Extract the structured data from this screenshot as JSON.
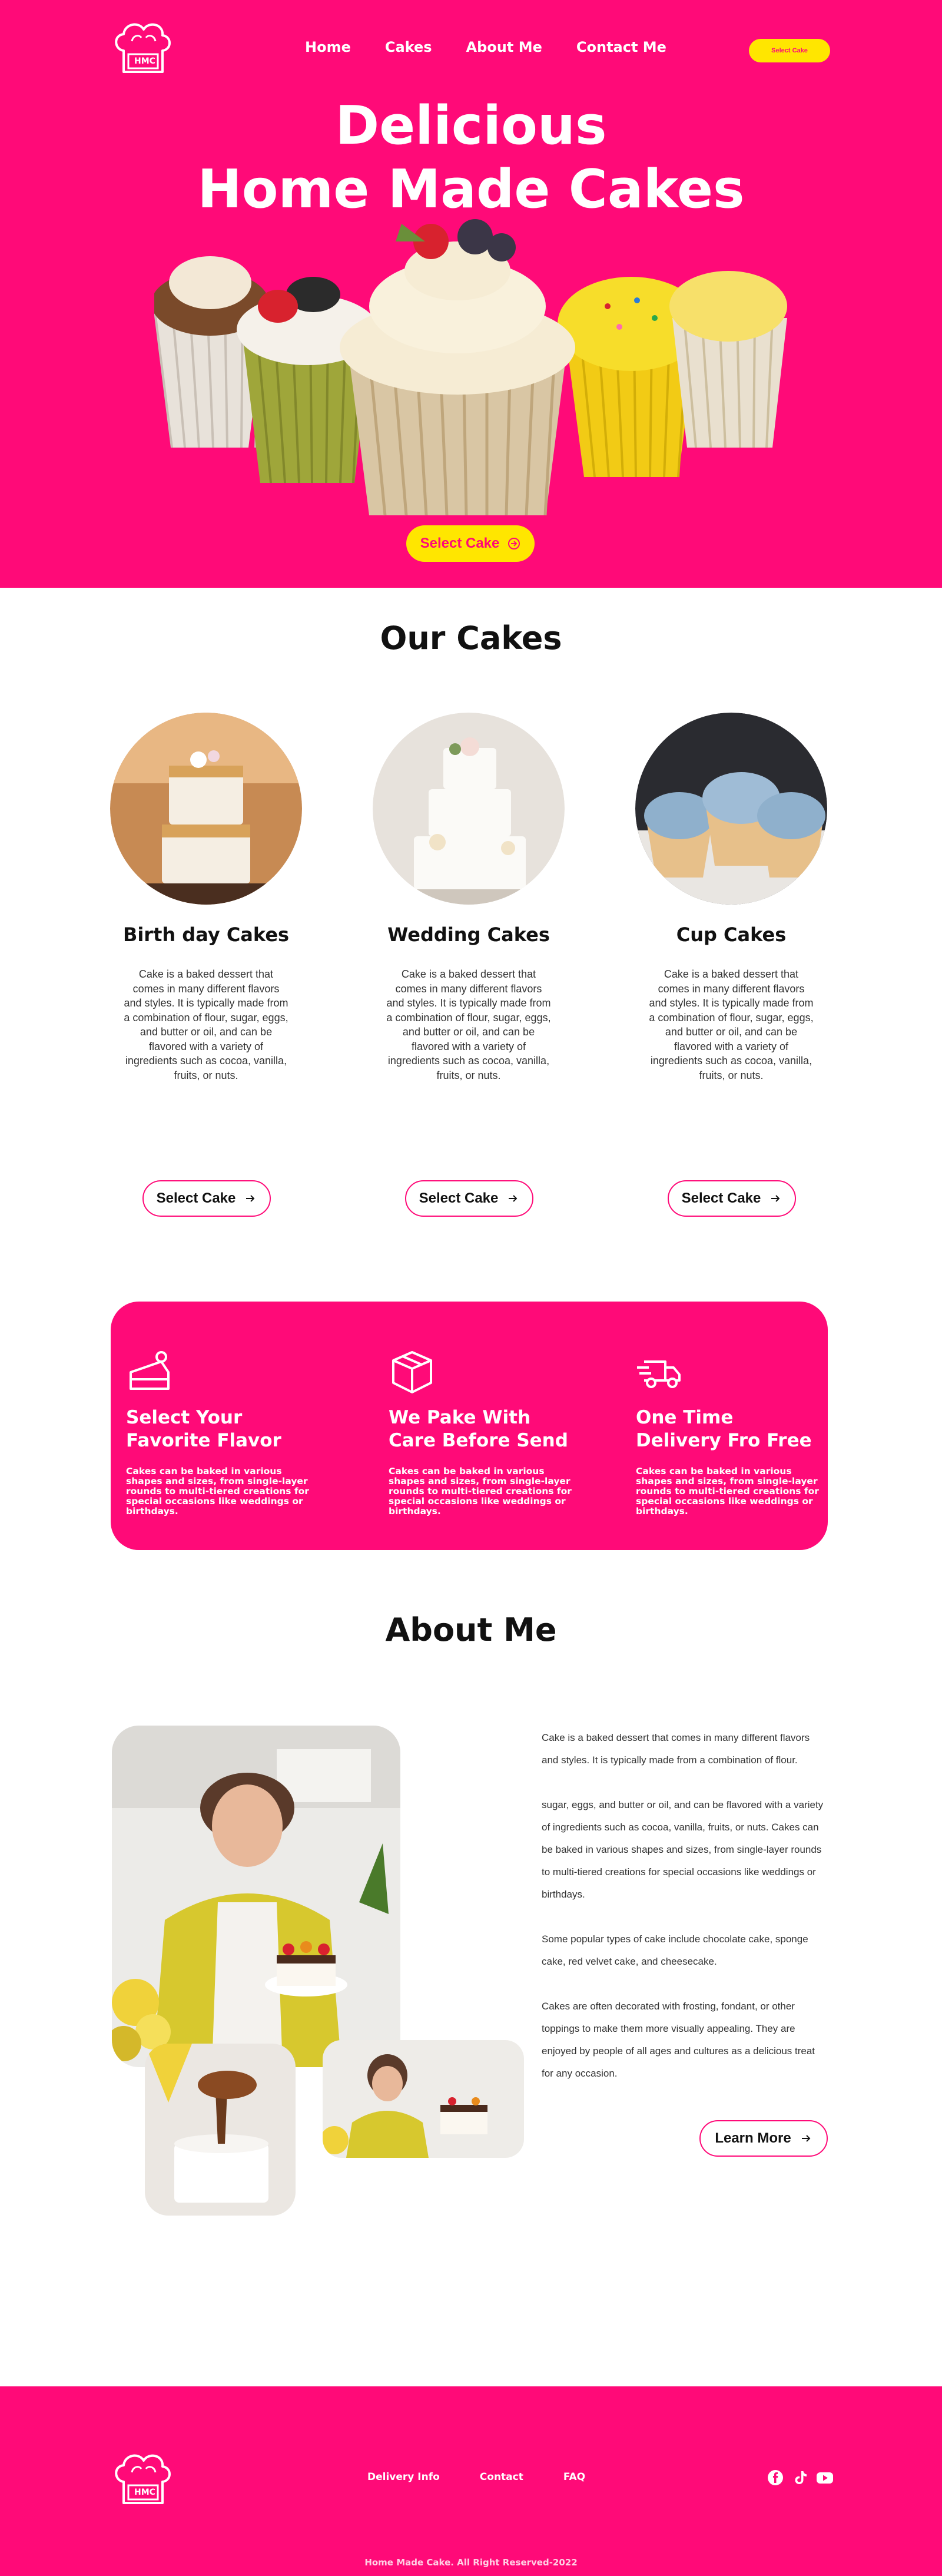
{
  "colors": {
    "brand_pink": "#ff0a78",
    "accent_yellow": "#ffe600",
    "white": "#ffffff"
  },
  "logo": {
    "text": "HMC"
  },
  "nav": {
    "items": [
      {
        "label": "Home"
      },
      {
        "label": "Cakes"
      },
      {
        "label": "About Me"
      },
      {
        "label": "Contact Me"
      }
    ],
    "cta_label": "Select Cake"
  },
  "hero": {
    "title_line1": "Delicious",
    "title_line2": "Home Made Cakes",
    "cta_label": "Select Cake",
    "image": "cupcakes-row"
  },
  "cakes": {
    "title": "Our Cakes",
    "items": [
      {
        "name": "Birth day Cakes",
        "image": "birthday-cake",
        "description": "Cake is a baked dessert that comes in many different flavors and styles. It is typically made from a combination of flour, sugar, eggs, and butter or oil, and can be flavored with a variety of ingredients such as cocoa, vanilla, fruits, or nuts.",
        "button_label": "Select Cake"
      },
      {
        "name": "Wedding Cakes",
        "image": "wedding-cake",
        "description": "Cake is a baked dessert that comes in many different flavors and styles. It is typically made from a combination of flour, sugar, eggs, and butter or oil, and can be flavored with a variety of ingredients such as cocoa, vanilla, fruits, or nuts.",
        "button_label": "Select Cake"
      },
      {
        "name": "Cup Cakes",
        "image": "cupcakes",
        "description": "Cake is a baked dessert that comes in many different flavors and styles. It is typically made from a combination of flour, sugar, eggs, and butter or oil, and can be flavored with a variety of ingredients such as cocoa, vanilla, fruits, or nuts.",
        "button_label": "Select Cake"
      }
    ]
  },
  "features": [
    {
      "icon": "cake-slice-icon",
      "title": "Select Your Favorite Flavor",
      "text": "Cakes can be baked in various shapes and sizes, from single-layer rounds to multi-tiered creations for special occasions like weddings or birthdays."
    },
    {
      "icon": "box-icon",
      "title": "We Pake With Care Before Send",
      "text": "Cakes can be baked in various shapes and sizes, from single-layer rounds to multi-tiered creations for special occasions like weddings or birthdays."
    },
    {
      "icon": "delivery-truck-icon",
      "title": "One Time Delivery Fro Free",
      "text": "Cakes can be baked in various shapes and sizes, from single-layer rounds to multi-tiered creations for special occasions like weddings or birthdays."
    }
  ],
  "about": {
    "title": "About Me",
    "paragraphs": [
      "Cake is a baked dessert that comes in many different flavors and styles. It is typically made from a combination of flour.",
      "sugar, eggs, and butter or oil, and can be flavored with a variety of ingredients such as cocoa, vanilla, fruits, or nuts. Cakes can be baked in various shapes and sizes, from single-layer rounds to multi-tiered creations for special occasions like weddings or birthdays.",
      "Some popular types of cake include chocolate cake, sponge cake, red velvet cake, and cheesecake.",
      "Cakes are often decorated with frosting, fondant, or other toppings to make them more visually appealing. They are enjoyed by people of all ages and cultures as a delicious treat for any occasion."
    ],
    "button_label": "Learn More"
  },
  "footer": {
    "links": [
      {
        "label": "Delivery Info"
      },
      {
        "label": "Contact"
      },
      {
        "label": "FAQ"
      }
    ],
    "social": [
      "facebook-icon",
      "tiktok-icon",
      "youtube-icon"
    ],
    "copyright": "Home Made Cake. All Right Reserved-2022"
  }
}
